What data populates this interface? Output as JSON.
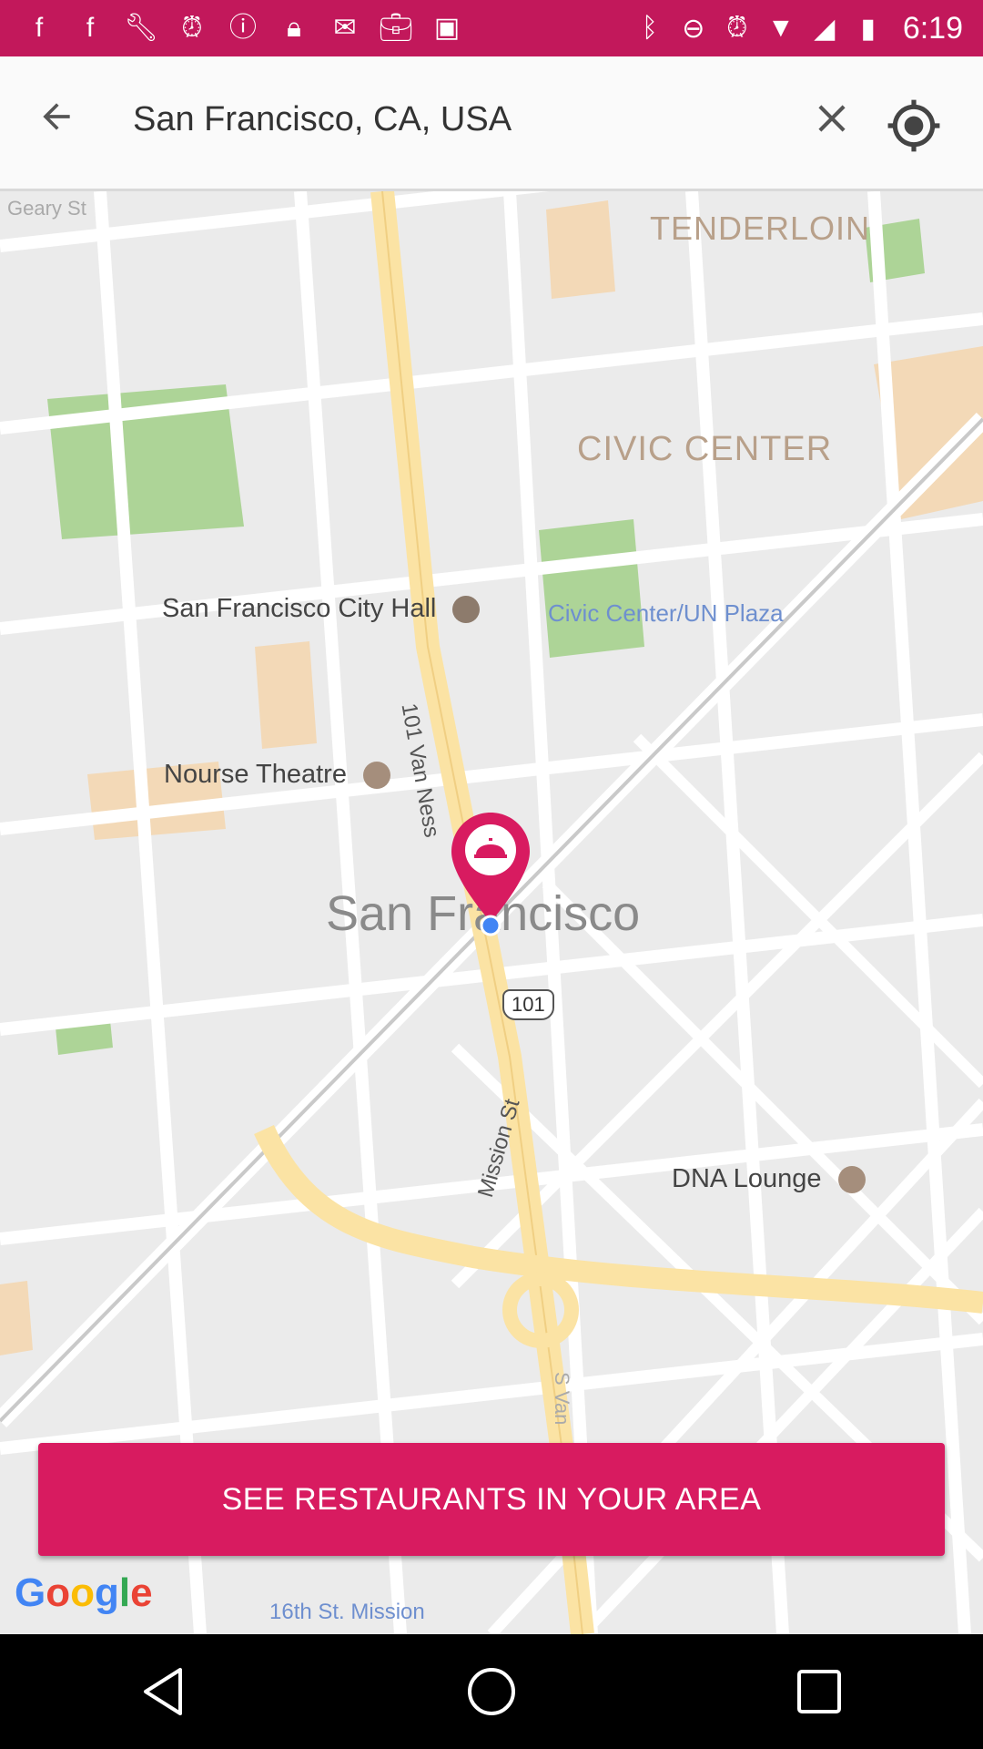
{
  "status_bar": {
    "time": "6:19",
    "icons": [
      "facebook-icon",
      "facebook-icon",
      "wrench-icon",
      "alarm-icon",
      "info-icon",
      "lock-icon",
      "inbox-icon",
      "briefcase-icon",
      "robot-icon",
      "bluetooth-icon",
      "dnd-icon",
      "alarm-icon"
    ]
  },
  "search": {
    "value": "San Francisco, CA, USA"
  },
  "map": {
    "labels": {
      "geary": "Geary St",
      "tenderloin": "TENDERLOIN",
      "civic_center": "CIVIC CENTER",
      "city_hall": "San Francisco City Hall",
      "civic_plaza": "Civic Center/UN Plaza",
      "nourse": "Nourse Theatre",
      "van_ness": "101  Van Ness",
      "san_francisco": "San Francisco",
      "shield_101": "101",
      "mission_st": "Mission St",
      "dna_lounge": "DNA Lounge",
      "s_van": "S Van",
      "sixteenth": "16th St. Mission"
    },
    "colors": {
      "park": "#a6d18e",
      "road_major": "#fbe3a4",
      "building": "#f3d9b7",
      "pin": "#d81b60",
      "location_dot": "#4285f4"
    }
  },
  "cta": {
    "label": "SEE RESTAURANTS IN YOUR AREA"
  },
  "google_logo": {
    "letters": [
      "G",
      "o",
      "o",
      "g",
      "l",
      "e"
    ],
    "colors": [
      "#4285f4",
      "#ea4335",
      "#fbbc05",
      "#4285f4",
      "#34a853",
      "#ea4335"
    ]
  }
}
